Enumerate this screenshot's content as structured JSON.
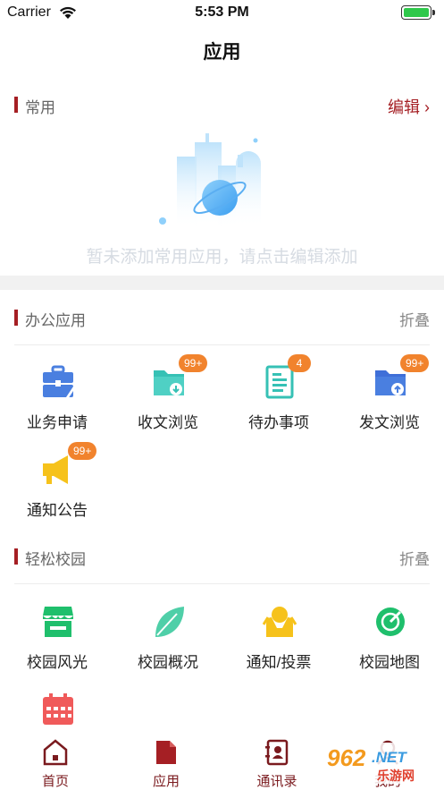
{
  "status_bar": {
    "carrier": "Carrier",
    "time": "5:53 PM"
  },
  "nav": {
    "title": "应用"
  },
  "favorites": {
    "title": "常用",
    "action": "编辑",
    "empty_text": "暂未添加常用应用，请点击编辑添加"
  },
  "office": {
    "title": "办公应用",
    "action": "折叠",
    "items": [
      {
        "label": "业务申请",
        "icon": "toolbox-icon"
      },
      {
        "label": "收文浏览",
        "icon": "folder-download-icon",
        "badge": "99+"
      },
      {
        "label": "待办事项",
        "icon": "document-list-icon",
        "badge": "4"
      },
      {
        "label": "发文浏览",
        "icon": "folder-upload-icon",
        "badge": "99+"
      },
      {
        "label": "通知公告",
        "icon": "megaphone-icon",
        "badge": "99+"
      }
    ]
  },
  "campus": {
    "title": "轻松校园",
    "action": "折叠",
    "items": [
      {
        "label": "校园风光",
        "icon": "storefront-icon"
      },
      {
        "label": "校园概况",
        "icon": "leaf-icon"
      },
      {
        "label": "通知/投票",
        "icon": "people-icon"
      },
      {
        "label": "校园地图",
        "icon": "map-compass-icon"
      },
      {
        "label": "",
        "icon": "calendar-icon"
      }
    ]
  },
  "tab_bar": {
    "items": [
      {
        "label": "首页",
        "icon": "home-icon"
      },
      {
        "label": "应用",
        "icon": "apps-document-icon"
      },
      {
        "label": "通讯录",
        "icon": "contacts-icon"
      },
      {
        "label": "我的",
        "icon": "profile-icon"
      }
    ]
  },
  "watermark": {
    "brand": "962.NET",
    "sub": "乐游网"
  },
  "colors": {
    "accent": "#a51f24",
    "badge": "#f1832d",
    "blue": "#4a7fe0",
    "teal": "#36c1b5",
    "yellow": "#f6c21b",
    "green": "#1fbf6c",
    "red": "#f05a5a"
  }
}
